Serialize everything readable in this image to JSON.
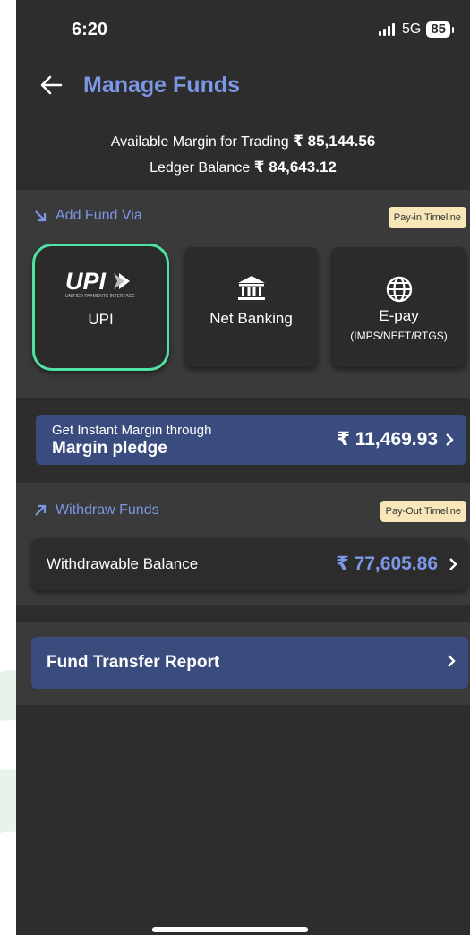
{
  "status": {
    "time": "6:20",
    "network": "5G",
    "battery": "85"
  },
  "header": {
    "title": "Manage Funds",
    "back_icon": "arrow-left-icon"
  },
  "summary": {
    "available_label": "Available Margin for Trading",
    "available_value": "₹ 85,144.56",
    "ledger_label": "Ledger Balance",
    "ledger_value": "₹ 84,643.12"
  },
  "add_fund": {
    "title": "Add Fund Via",
    "timeline": "Pay-in Timeline",
    "options": [
      {
        "label": "UPI",
        "logo_text": "UPI",
        "logo_tagline": "UNIFIED PAYMENTS INTERFACE"
      },
      {
        "label": "Net Banking"
      },
      {
        "label": "E-pay",
        "sub": "(IMPS/NEFT/RTGS)"
      }
    ]
  },
  "pledge": {
    "line1": "Get Instant Margin through",
    "line2": "Margin pledge",
    "amount": "₹ 11,469.93"
  },
  "withdraw": {
    "title": "Withdraw Funds",
    "timeline": "Pay-Out Timeline",
    "label": "Withdrawable Balance",
    "amount": "₹ 77,605.86"
  },
  "report": {
    "label": "Fund Transfer Report"
  },
  "colors": {
    "accent": "#7b97e6",
    "selected_border": "#4ee3a2",
    "banner": "#3a4b7e",
    "background": "#2d2d2d",
    "panel": "#3a3a3a"
  }
}
